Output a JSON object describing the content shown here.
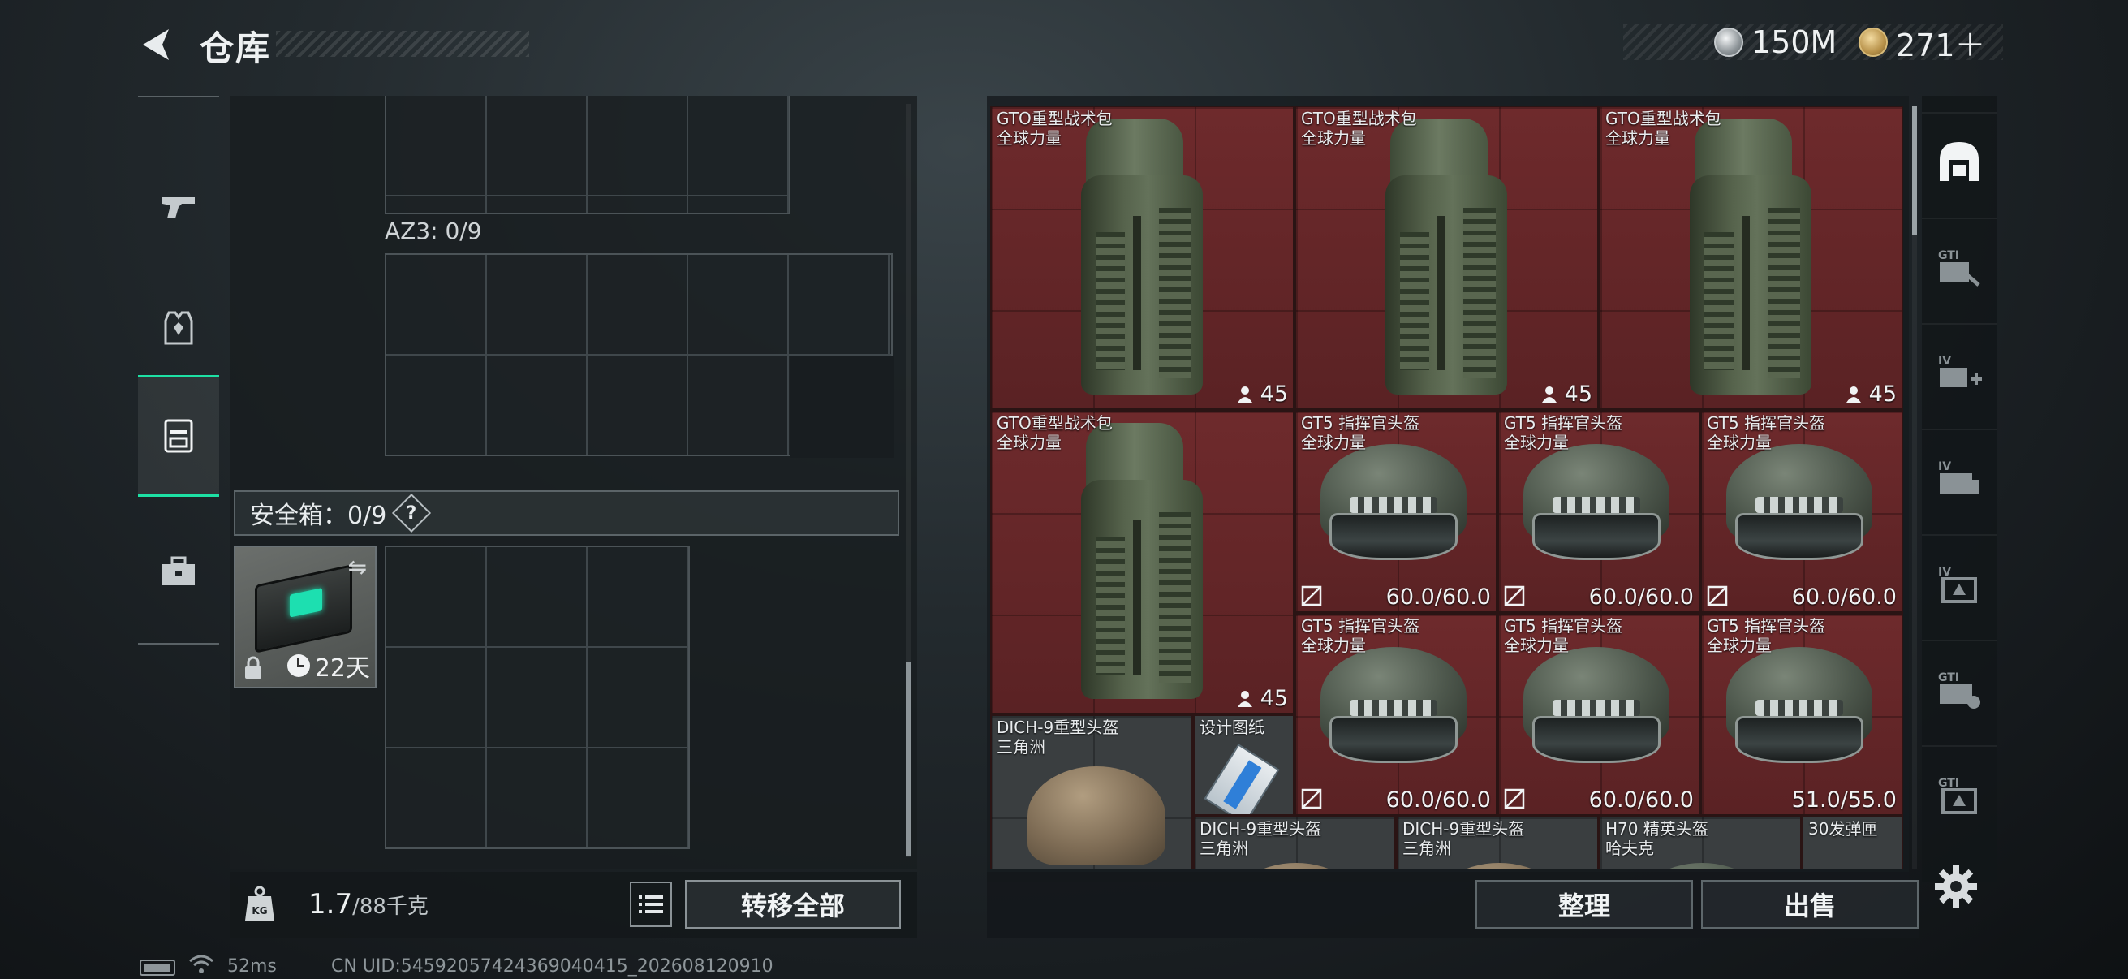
{
  "header": {
    "title": "仓库",
    "currencies": [
      {
        "icon": "silver-coin-icon",
        "value": "150M"
      },
      {
        "icon": "gold-coin-icon",
        "value": "271＋"
      }
    ]
  },
  "sidebar": {
    "items": [
      {
        "name": "weapons",
        "icon": "pistol-icon"
      },
      {
        "name": "armor",
        "icon": "vest-icon"
      },
      {
        "name": "backpack",
        "icon": "backpack-icon",
        "active": true
      },
      {
        "name": "toolbox",
        "icon": "briefcase-icon"
      }
    ]
  },
  "left_panel": {
    "az3_label": "AZ3: 0/9",
    "safe_box_label": "安全箱：0/9",
    "help_label": "?",
    "safe_item_timer": "22天",
    "weight_value": "1.7",
    "weight_max": "/88千克",
    "transfer_all_label": "转移全部"
  },
  "right_panel": {
    "items": [
      {
        "name_line1": "GTO重型战术包",
        "name_line2": "全球力量",
        "value": "45",
        "type": "backpack"
      },
      {
        "name_line1": "GTO重型战术包",
        "name_line2": "全球力量",
        "value": "45",
        "type": "backpack"
      },
      {
        "name_line1": "GTO重型战术包",
        "name_line2": "全球力量",
        "value": "45",
        "type": "backpack"
      },
      {
        "name_line1": "GTO重型战术包",
        "name_line2": "全球力量",
        "value": "45",
        "type": "backpack"
      },
      {
        "name_line1": "GT5 指挥官头盔",
        "name_line2": "全球力量",
        "value": "60.0/60.0",
        "type": "helmet"
      },
      {
        "name_line1": "GT5 指挥官头盔",
        "name_line2": "全球力量",
        "value": "60.0/60.0",
        "type": "helmet"
      },
      {
        "name_line1": "GT5 指挥官头盔",
        "name_line2": "全球力量",
        "value": "60.0/60.0",
        "type": "helmet"
      },
      {
        "name_line1": "GT5 指挥官头盔",
        "name_line2": "全球力量",
        "value": "60.0/60.0",
        "type": "helmet"
      },
      {
        "name_line1": "GT5 指挥官头盔",
        "name_line2": "全球力量",
        "value": "60.0/60.0",
        "type": "helmet"
      },
      {
        "name_line1": "GT5 指挥官头盔",
        "name_line2": "全球力量",
        "value": "51.0/55.0",
        "type": "helmet"
      },
      {
        "name_line1": "DICH-9重型头盔",
        "name_line2": "三角洲",
        "value": "",
        "type": "helmet"
      },
      {
        "name_line1": "设计图纸",
        "name_line2": "",
        "value": "",
        "type": "blueprint"
      },
      {
        "name_line1": "DICH-9重型头盔",
        "name_line2": "三角洲",
        "value": "",
        "type": "helmet"
      },
      {
        "name_line1": "DICH-9重型头盔",
        "name_line2": "三角洲",
        "value": "",
        "type": "helmet"
      },
      {
        "name_line1": "H70 精英头盔",
        "name_line2": "哈夫克",
        "value": "",
        "type": "helmet"
      },
      {
        "name_line1": "30发弹匣",
        "name_line2": "",
        "value": "",
        "type": "magazine"
      }
    ],
    "sort_label": "整理",
    "sell_label": "出售"
  },
  "right_rail": {
    "tabs": [
      {
        "name": "all",
        "icon": "warehouse-icon",
        "active": true
      },
      {
        "name": "gti-1",
        "icon": "gti-crate-icon"
      },
      {
        "name": "iv-add",
        "icon": "iv-add-icon"
      },
      {
        "name": "iv-2",
        "icon": "iv-crate-icon"
      },
      {
        "name": "iv-3",
        "icon": "iv-armor-icon"
      },
      {
        "name": "gti-2",
        "icon": "gti-box-icon"
      },
      {
        "name": "gti-3",
        "icon": "gti-armor-icon"
      }
    ],
    "settings_icon": "gear-icon"
  },
  "status_bar": {
    "ping": "52ms",
    "uid": "CN UID:54592057424369040415_202608120910"
  }
}
